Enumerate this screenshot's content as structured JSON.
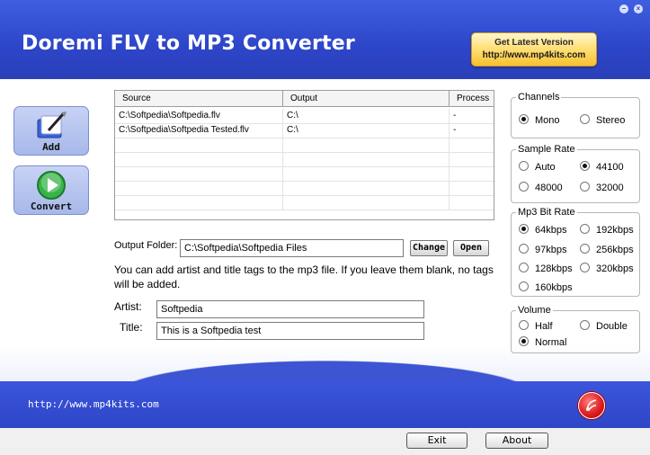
{
  "window": {
    "title": "Doremi FLV to MP3 Converter"
  },
  "header": {
    "latest_line1": "Get Latest Version",
    "latest_line2": "http://www.mp4kits.com"
  },
  "toolbar": {
    "add_label": "Add",
    "convert_label": "Convert"
  },
  "table": {
    "headers": [
      "Source",
      "Output",
      "Process"
    ],
    "rows": [
      {
        "source": "C:\\Softpedia\\Softpedia.flv",
        "output": "C:\\",
        "process": "-"
      },
      {
        "source": "C:\\Softpedia\\Softpedia Tested.flv",
        "output": "C:\\",
        "process": "-"
      }
    ]
  },
  "output": {
    "label": "Output Folder:",
    "value": "C:\\Softpedia\\Softpedia Files",
    "change_label": "Change",
    "open_label": "Open"
  },
  "note": "You can add artist and title tags to the mp3 file. If you leave them blank, no tags will be added.",
  "tags": {
    "artist_label": "Artist:",
    "artist_value": "Softpedia",
    "title_label": "Title:",
    "title_value": "This is a Softpedia test"
  },
  "settings": {
    "channels": {
      "title": "Channels",
      "options": [
        "Mono",
        "Stereo"
      ],
      "selected": "Mono"
    },
    "sample_rate": {
      "title": "Sample Rate",
      "options": [
        "Auto",
        "44100",
        "48000",
        "32000"
      ],
      "selected": "44100"
    },
    "bit_rate": {
      "title": "Mp3 Bit Rate",
      "options": [
        "64kbps",
        "192kbps",
        "97kbps",
        "256kbps",
        "128kbps",
        "320kbps",
        "160kbps"
      ],
      "selected": "64kbps"
    },
    "volume": {
      "title": "Volume",
      "options": [
        "Half",
        "Double",
        "Normal"
      ],
      "selected": "Normal"
    }
  },
  "footer": {
    "url": "http://www.mp4kits.com",
    "exit_label": "Exit",
    "about_label": "About"
  },
  "colors": {
    "header_blue": "#2d45c9",
    "button_blue": "#a7b8ea",
    "gold": "#f7c130"
  }
}
